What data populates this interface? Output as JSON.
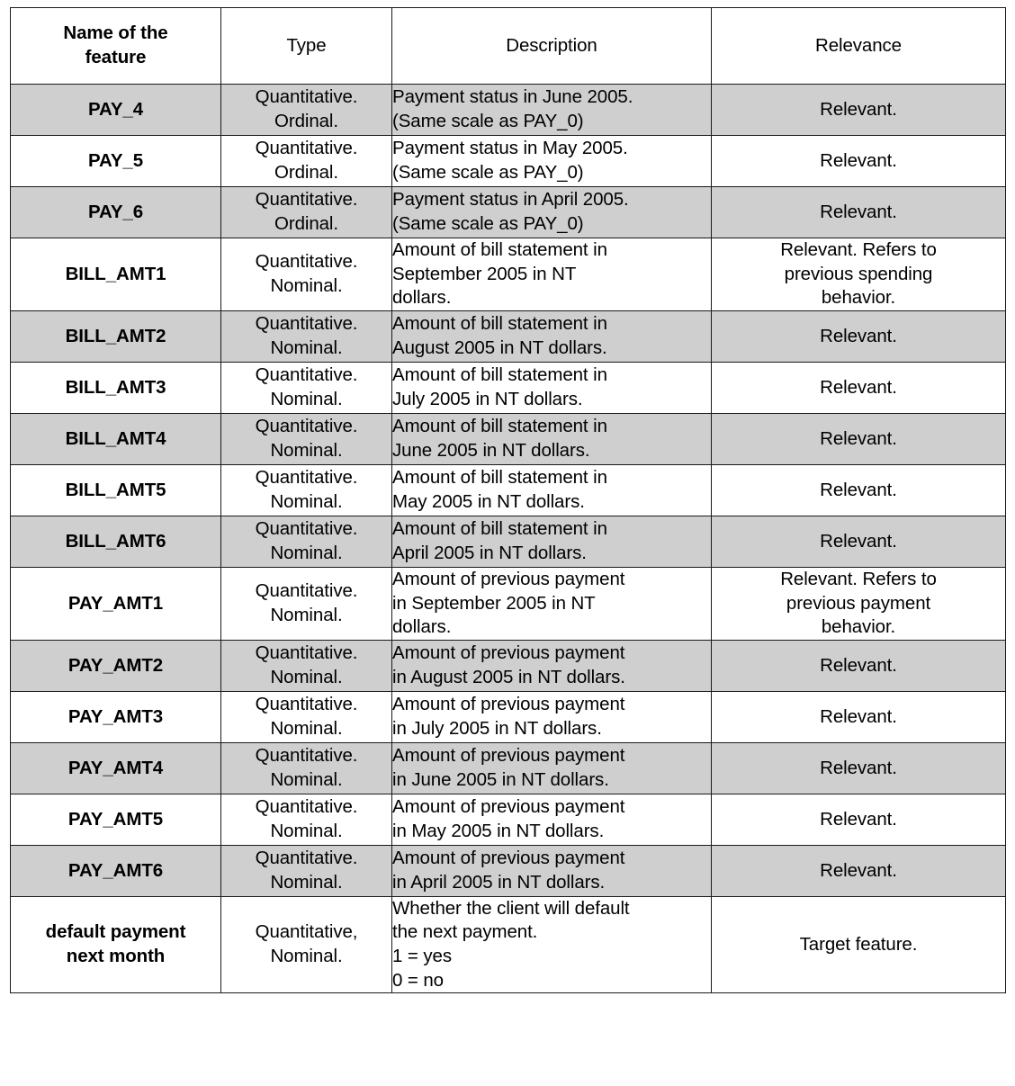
{
  "table": {
    "headers": [
      "Name of the\nfeature",
      "Type",
      "Description",
      "Relevance"
    ],
    "rows": [
      {
        "name": "PAY_4",
        "type": "Quantitative.\nOrdinal.",
        "description": "Payment status in June 2005.\n(Same scale as PAY_0)",
        "relevance": "Relevant.",
        "shaded": true
      },
      {
        "name": "PAY_5",
        "type": "Quantitative.\nOrdinal.",
        "description": "Payment status in May 2005.\n(Same scale as PAY_0)",
        "relevance": "Relevant.",
        "shaded": false
      },
      {
        "name": "PAY_6",
        "type": "Quantitative.\nOrdinal.",
        "description": "Payment status in April 2005.\n(Same scale as PAY_0)",
        "relevance": "Relevant.",
        "shaded": true
      },
      {
        "name": "BILL_AMT1",
        "type": "Quantitative.\nNominal.",
        "description": "Amount of bill statement in\nSeptember 2005 in NT\ndollars.",
        "relevance": "Relevant. Refers to\nprevious spending\nbehavior.",
        "shaded": false
      },
      {
        "name": "BILL_AMT2",
        "type": "Quantitative.\nNominal.",
        "description": "Amount of bill statement in\nAugust 2005 in NT dollars.",
        "relevance": "Relevant.",
        "shaded": true
      },
      {
        "name": "BILL_AMT3",
        "type": "Quantitative.\nNominal.",
        "description": "Amount of bill statement in\nJuly 2005 in NT dollars.",
        "relevance": "Relevant.",
        "shaded": false
      },
      {
        "name": "BILL_AMT4",
        "type": "Quantitative.\nNominal.",
        "description": "Amount of bill statement in\nJune 2005 in NT dollars.",
        "relevance": "Relevant.",
        "shaded": true
      },
      {
        "name": "BILL_AMT5",
        "type": "Quantitative.\nNominal.",
        "description": "Amount of bill statement in\nMay 2005 in NT dollars.",
        "relevance": "Relevant.",
        "shaded": false
      },
      {
        "name": "BILL_AMT6",
        "type": "Quantitative.\nNominal.",
        "description": "Amount of bill statement in\nApril 2005 in NT dollars.",
        "relevance": "Relevant.",
        "shaded": true
      },
      {
        "name": "PAY_AMT1",
        "type": "Quantitative.\nNominal.",
        "description": "Amount of previous payment\nin September 2005 in NT\ndollars.",
        "relevance": "Relevant. Refers to\nprevious payment\nbehavior.",
        "shaded": false
      },
      {
        "name": "PAY_AMT2",
        "type": "Quantitative.\nNominal.",
        "description": "Amount of previous payment\nin August 2005 in NT dollars.",
        "relevance": "Relevant.",
        "shaded": true
      },
      {
        "name": "PAY_AMT3",
        "type": "Quantitative.\nNominal.",
        "description": "Amount of previous payment\nin July 2005 in NT dollars.",
        "relevance": "Relevant.",
        "shaded": false
      },
      {
        "name": "PAY_AMT4",
        "type": "Quantitative.\nNominal.",
        "description": "Amount of previous payment\nin June 2005 in NT dollars.",
        "relevance": "Relevant.",
        "shaded": true
      },
      {
        "name": "PAY_AMT5",
        "type": "Quantitative.\nNominal.",
        "description": "Amount of previous payment\nin May 2005 in NT dollars.",
        "relevance": "Relevant.",
        "shaded": false
      },
      {
        "name": "PAY_AMT6",
        "type": "Quantitative.\nNominal.",
        "description": "Amount of previous payment\nin April 2005 in NT dollars.",
        "relevance": "Relevant.",
        "shaded": true
      },
      {
        "name": "default payment\nnext month",
        "type": "Quantitative,\nNominal.",
        "description": "Whether the client will default\nthe next payment.\n1 = yes\n0 = no",
        "relevance": "Target feature.",
        "shaded": false
      }
    ]
  },
  "colors": {
    "shaded_row": "#cfcfcf",
    "plain_row": "#ffffff",
    "border": "#1a1a1a",
    "text": "#000000"
  }
}
